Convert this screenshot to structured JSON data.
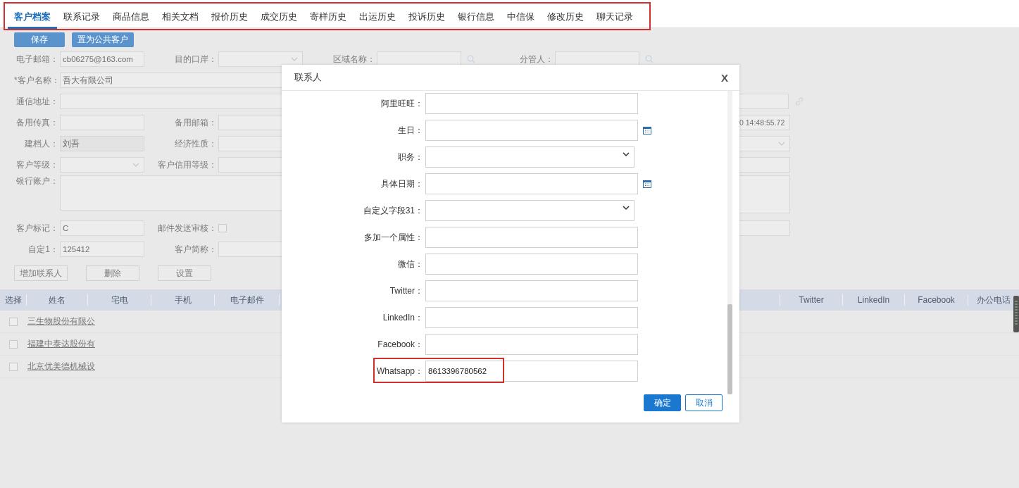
{
  "tab_bar": {
    "highlight": true,
    "tabs": [
      {
        "label": "客户档案",
        "selected": true
      },
      {
        "label": "联系记录",
        "selected": false
      },
      {
        "label": "商品信息",
        "selected": false
      },
      {
        "label": "相关文档",
        "selected": false
      },
      {
        "label": "报价历史",
        "selected": false
      },
      {
        "label": "成交历史",
        "selected": false
      },
      {
        "label": "寄样历史",
        "selected": false
      },
      {
        "label": "出运历史",
        "selected": false
      },
      {
        "label": "投诉历史",
        "selected": false
      },
      {
        "label": "银行信息",
        "selected": false
      },
      {
        "label": "中信保",
        "selected": false
      },
      {
        "label": "修改历史",
        "selected": false
      },
      {
        "label": "聊天记录",
        "selected": false
      }
    ]
  },
  "toolbar": {
    "buttons": [
      "保存",
      "置为公共客户"
    ]
  },
  "customer_form": {
    "rows": [
      [
        {
          "label": "电子邮箱：",
          "kind": "text",
          "value": "cb06275@163.com"
        },
        {
          "label": "目的口岸：",
          "kind": "select"
        },
        {
          "label": "区域名称：",
          "kind": "search"
        },
        {
          "label": "分管人：",
          "kind": "search"
        }
      ],
      [
        {
          "label": "*客户名称：",
          "kind": "wide",
          "value": "吾大有限公司"
        }
      ],
      [
        {
          "label": "通信地址：",
          "kind": "wide_link"
        }
      ],
      [
        {
          "label": "备用传真：",
          "kind": "text"
        },
        {
          "label": "备用邮箱：",
          "kind": "text"
        },
        {
          "kind": "right_text",
          "value": "0 14:48:55.72"
        }
      ],
      [
        {
          "label": "建档人：",
          "kind": "readonly",
          "value": "刘吾"
        },
        {
          "label": "经济性质：",
          "kind": "text"
        },
        {
          "kind": "right_select"
        }
      ],
      [
        {
          "label": "客户等级：",
          "kind": "select"
        },
        {
          "label": "客户信用等级：",
          "kind": "text"
        },
        {
          "kind": "right_text"
        }
      ],
      [
        {
          "label": "银行账户：",
          "kind": "wide"
        },
        {
          "kind": "right_textarea"
        }
      ],
      [
        {
          "label": "客户标记：",
          "kind": "text",
          "value": "C"
        },
        {
          "label": "邮件发送审核：",
          "kind": "checkbox",
          "checked": false
        },
        {
          "kind": "right_text"
        }
      ],
      [
        {
          "label": "自定1：",
          "kind": "text",
          "value": "125412"
        },
        {
          "label": "客户简称：",
          "kind": "text"
        }
      ]
    ]
  },
  "contact_actions": [
    "增加联系人",
    "删除",
    "设置"
  ],
  "contacts_table": {
    "columns_left": [
      "选择",
      "姓名",
      "宅电",
      "手机",
      "电子邮件"
    ],
    "columns_right": [
      "Twitter",
      "LinkedIn",
      "Facebook",
      "办公电话"
    ],
    "rows": [
      {
        "name": "三生物股份有限公",
        "selected": false
      },
      {
        "name": "福建中泰达股份有",
        "selected": false
      },
      {
        "name": "北京优美德机械设",
        "selected": false
      }
    ]
  },
  "dialog": {
    "title": "联系人",
    "close": "X",
    "fields": [
      {
        "label": "阿里旺旺：",
        "kind": "text",
        "highlight": false
      },
      {
        "label": "生日：",
        "kind": "date",
        "highlight": false
      },
      {
        "label": "职务：",
        "kind": "select",
        "highlight": false
      },
      {
        "label": "具体日期：",
        "kind": "date",
        "highlight": false
      },
      {
        "label": "自定义字段31：",
        "kind": "select",
        "highlight": false
      },
      {
        "label": "多加一个属性：",
        "kind": "text",
        "highlight": false
      },
      {
        "label": "微信：",
        "kind": "text",
        "highlight": false
      },
      {
        "label": "Twitter：",
        "kind": "text",
        "highlight": false
      },
      {
        "label": "LinkedIn：",
        "kind": "text",
        "highlight": false
      },
      {
        "label": "Facebook：",
        "kind": "text",
        "highlight": false
      },
      {
        "label": "Whatsapp：",
        "kind": "text",
        "value": "8613396780562",
        "highlight": true
      }
    ],
    "buttons": [
      {
        "label": "确定",
        "kind": "primary"
      },
      {
        "label": "取消",
        "kind": "default"
      }
    ]
  }
}
